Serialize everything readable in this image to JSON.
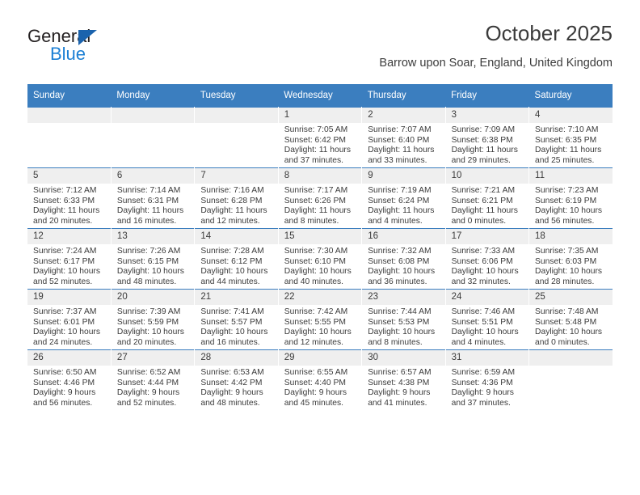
{
  "logo": {
    "word_top": "General",
    "word_bottom": "Blue",
    "triangle_color": "#1b63ad",
    "blue_color": "#1b7fd4"
  },
  "header": {
    "title": "October 2025",
    "subtitle": "Barrow upon Soar, England, United Kingdom"
  },
  "theme": {
    "header_blue": "#3b7ebf",
    "daynum_gray": "#efefef",
    "text": "#3b3b3b"
  },
  "calendar": {
    "weekday_headers": [
      "Sunday",
      "Monday",
      "Tuesday",
      "Wednesday",
      "Thursday",
      "Friday",
      "Saturday"
    ],
    "weeks": [
      [
        {
          "day": "",
          "lines": []
        },
        {
          "day": "",
          "lines": []
        },
        {
          "day": "",
          "lines": []
        },
        {
          "day": "1",
          "lines": [
            "Sunrise: 7:05 AM",
            "Sunset: 6:42 PM",
            "Daylight: 11 hours",
            "and 37 minutes."
          ]
        },
        {
          "day": "2",
          "lines": [
            "Sunrise: 7:07 AM",
            "Sunset: 6:40 PM",
            "Daylight: 11 hours",
            "and 33 minutes."
          ]
        },
        {
          "day": "3",
          "lines": [
            "Sunrise: 7:09 AM",
            "Sunset: 6:38 PM",
            "Daylight: 11 hours",
            "and 29 minutes."
          ]
        },
        {
          "day": "4",
          "lines": [
            "Sunrise: 7:10 AM",
            "Sunset: 6:35 PM",
            "Daylight: 11 hours",
            "and 25 minutes."
          ]
        }
      ],
      [
        {
          "day": "5",
          "lines": [
            "Sunrise: 7:12 AM",
            "Sunset: 6:33 PM",
            "Daylight: 11 hours",
            "and 20 minutes."
          ]
        },
        {
          "day": "6",
          "lines": [
            "Sunrise: 7:14 AM",
            "Sunset: 6:31 PM",
            "Daylight: 11 hours",
            "and 16 minutes."
          ]
        },
        {
          "day": "7",
          "lines": [
            "Sunrise: 7:16 AM",
            "Sunset: 6:28 PM",
            "Daylight: 11 hours",
            "and 12 minutes."
          ]
        },
        {
          "day": "8",
          "lines": [
            "Sunrise: 7:17 AM",
            "Sunset: 6:26 PM",
            "Daylight: 11 hours",
            "and 8 minutes."
          ]
        },
        {
          "day": "9",
          "lines": [
            "Sunrise: 7:19 AM",
            "Sunset: 6:24 PM",
            "Daylight: 11 hours",
            "and 4 minutes."
          ]
        },
        {
          "day": "10",
          "lines": [
            "Sunrise: 7:21 AM",
            "Sunset: 6:21 PM",
            "Daylight: 11 hours",
            "and 0 minutes."
          ]
        },
        {
          "day": "11",
          "lines": [
            "Sunrise: 7:23 AM",
            "Sunset: 6:19 PM",
            "Daylight: 10 hours",
            "and 56 minutes."
          ]
        }
      ],
      [
        {
          "day": "12",
          "lines": [
            "Sunrise: 7:24 AM",
            "Sunset: 6:17 PM",
            "Daylight: 10 hours",
            "and 52 minutes."
          ]
        },
        {
          "day": "13",
          "lines": [
            "Sunrise: 7:26 AM",
            "Sunset: 6:15 PM",
            "Daylight: 10 hours",
            "and 48 minutes."
          ]
        },
        {
          "day": "14",
          "lines": [
            "Sunrise: 7:28 AM",
            "Sunset: 6:12 PM",
            "Daylight: 10 hours",
            "and 44 minutes."
          ]
        },
        {
          "day": "15",
          "lines": [
            "Sunrise: 7:30 AM",
            "Sunset: 6:10 PM",
            "Daylight: 10 hours",
            "and 40 minutes."
          ]
        },
        {
          "day": "16",
          "lines": [
            "Sunrise: 7:32 AM",
            "Sunset: 6:08 PM",
            "Daylight: 10 hours",
            "and 36 minutes."
          ]
        },
        {
          "day": "17",
          "lines": [
            "Sunrise: 7:33 AM",
            "Sunset: 6:06 PM",
            "Daylight: 10 hours",
            "and 32 minutes."
          ]
        },
        {
          "day": "18",
          "lines": [
            "Sunrise: 7:35 AM",
            "Sunset: 6:03 PM",
            "Daylight: 10 hours",
            "and 28 minutes."
          ]
        }
      ],
      [
        {
          "day": "19",
          "lines": [
            "Sunrise: 7:37 AM",
            "Sunset: 6:01 PM",
            "Daylight: 10 hours",
            "and 24 minutes."
          ]
        },
        {
          "day": "20",
          "lines": [
            "Sunrise: 7:39 AM",
            "Sunset: 5:59 PM",
            "Daylight: 10 hours",
            "and 20 minutes."
          ]
        },
        {
          "day": "21",
          "lines": [
            "Sunrise: 7:41 AM",
            "Sunset: 5:57 PM",
            "Daylight: 10 hours",
            "and 16 minutes."
          ]
        },
        {
          "day": "22",
          "lines": [
            "Sunrise: 7:42 AM",
            "Sunset: 5:55 PM",
            "Daylight: 10 hours",
            "and 12 minutes."
          ]
        },
        {
          "day": "23",
          "lines": [
            "Sunrise: 7:44 AM",
            "Sunset: 5:53 PM",
            "Daylight: 10 hours",
            "and 8 minutes."
          ]
        },
        {
          "day": "24",
          "lines": [
            "Sunrise: 7:46 AM",
            "Sunset: 5:51 PM",
            "Daylight: 10 hours",
            "and 4 minutes."
          ]
        },
        {
          "day": "25",
          "lines": [
            "Sunrise: 7:48 AM",
            "Sunset: 5:48 PM",
            "Daylight: 10 hours",
            "and 0 minutes."
          ]
        }
      ],
      [
        {
          "day": "26",
          "lines": [
            "Sunrise: 6:50 AM",
            "Sunset: 4:46 PM",
            "Daylight: 9 hours",
            "and 56 minutes."
          ]
        },
        {
          "day": "27",
          "lines": [
            "Sunrise: 6:52 AM",
            "Sunset: 4:44 PM",
            "Daylight: 9 hours",
            "and 52 minutes."
          ]
        },
        {
          "day": "28",
          "lines": [
            "Sunrise: 6:53 AM",
            "Sunset: 4:42 PM",
            "Daylight: 9 hours",
            "and 48 minutes."
          ]
        },
        {
          "day": "29",
          "lines": [
            "Sunrise: 6:55 AM",
            "Sunset: 4:40 PM",
            "Daylight: 9 hours",
            "and 45 minutes."
          ]
        },
        {
          "day": "30",
          "lines": [
            "Sunrise: 6:57 AM",
            "Sunset: 4:38 PM",
            "Daylight: 9 hours",
            "and 41 minutes."
          ]
        },
        {
          "day": "31",
          "lines": [
            "Sunrise: 6:59 AM",
            "Sunset: 4:36 PM",
            "Daylight: 9 hours",
            "and 37 minutes."
          ]
        },
        {
          "day": "",
          "lines": []
        }
      ]
    ]
  }
}
